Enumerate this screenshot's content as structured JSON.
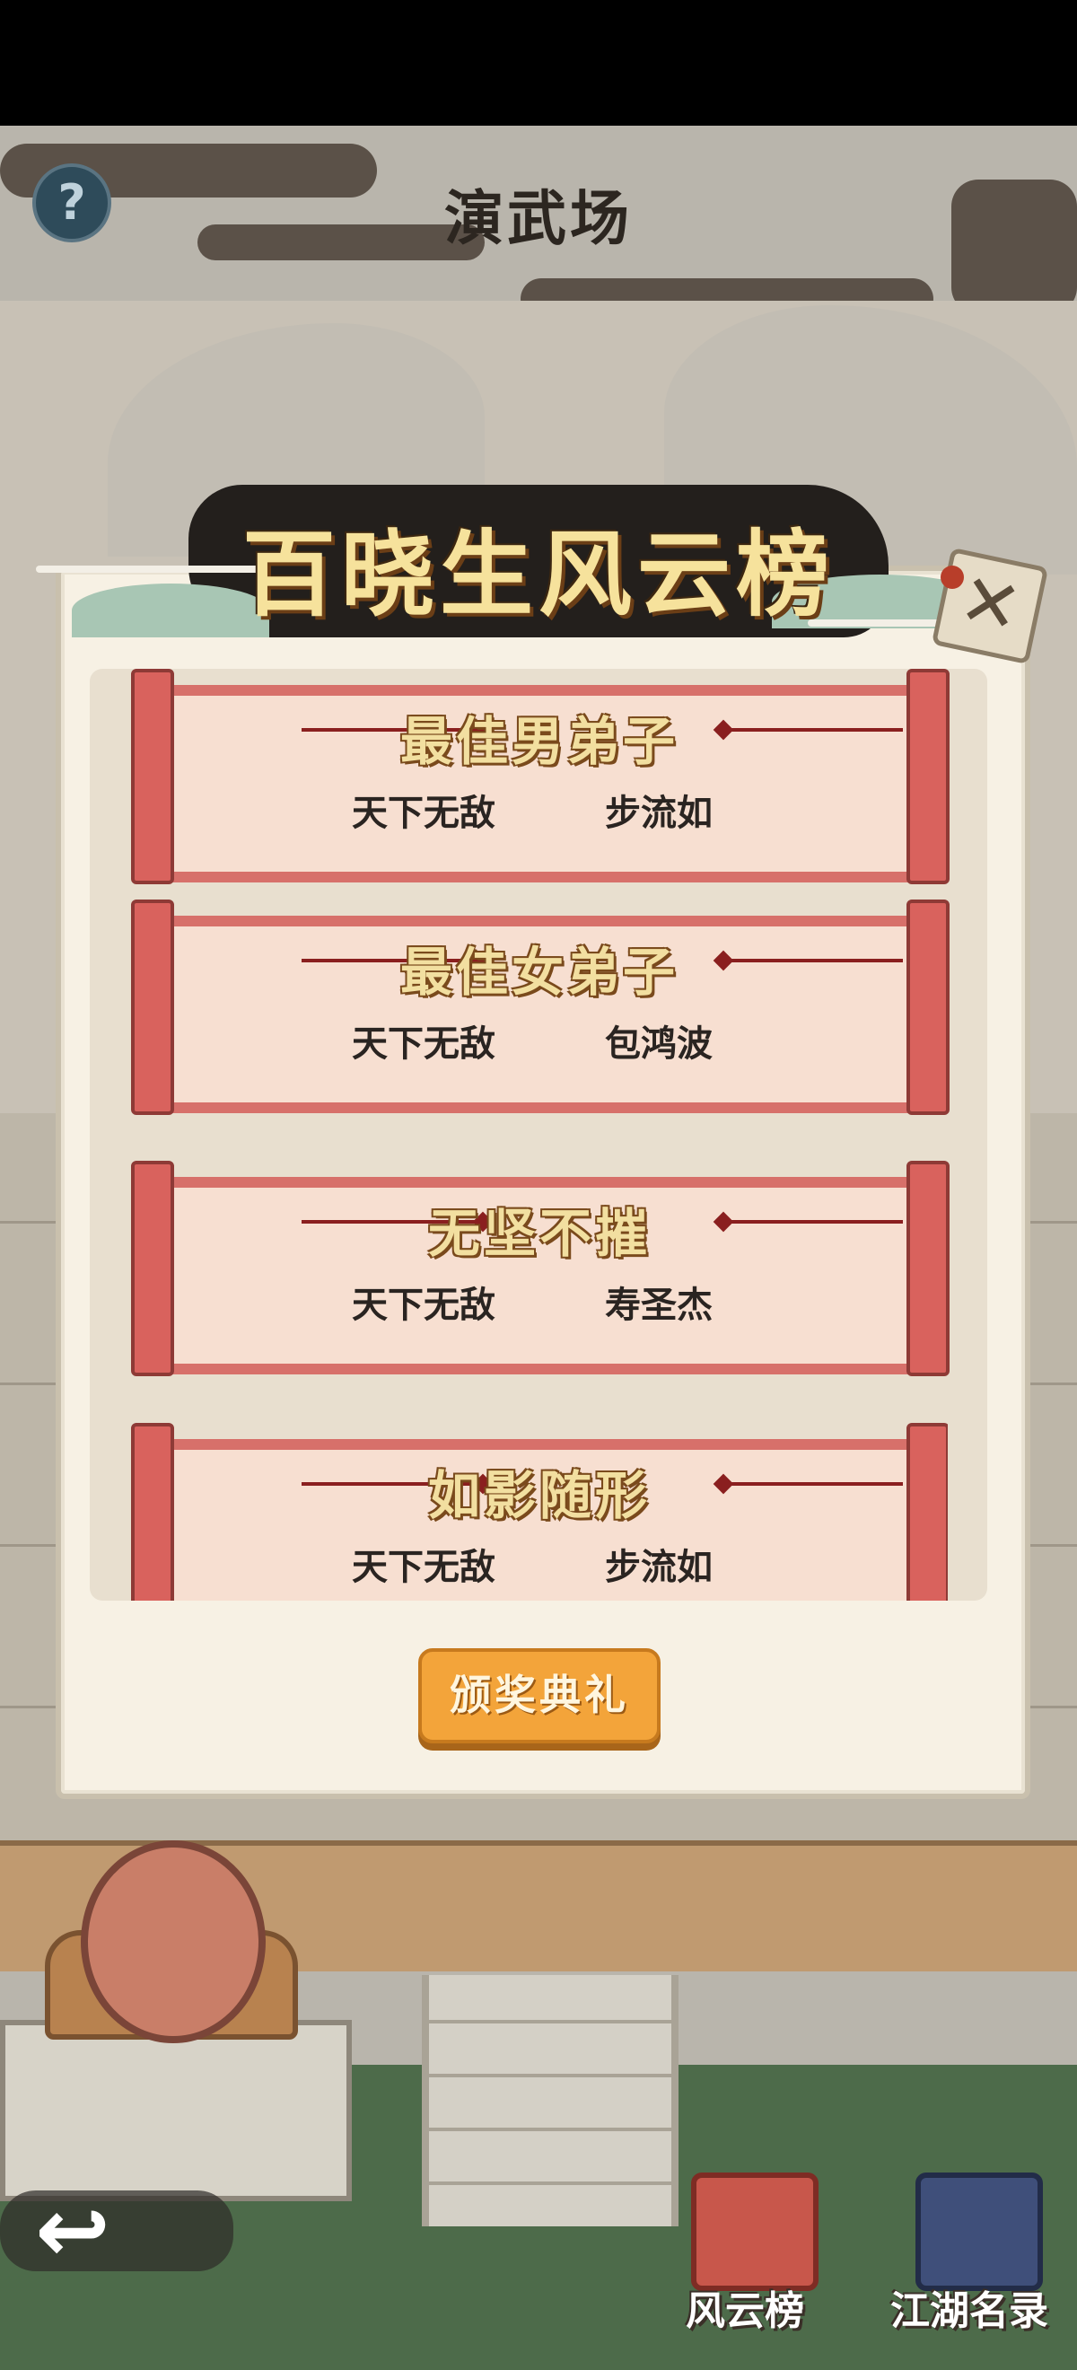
{
  "header": {
    "title": "演武场",
    "help_glyph": "?"
  },
  "dialog": {
    "title": "百晓生风云榜",
    "close_glyph": "✕",
    "entries": [
      {
        "title": "最佳男弟子",
        "rank": "天下无敌",
        "name": "步流如"
      },
      {
        "title": "最佳女弟子",
        "rank": "天下无敌",
        "name": "包鸿波"
      },
      {
        "title": "无坚不摧",
        "rank": "天下无敌",
        "name": "寿圣杰"
      },
      {
        "title": "如影随形",
        "rank": "天下无敌",
        "name": "步流如"
      }
    ],
    "award_button": "颁奖典礼"
  },
  "bottom_nav": {
    "back_glyph": "↩",
    "items": [
      {
        "label": "风云榜",
        "icon": "scroll-icon"
      },
      {
        "label": "江湖名录",
        "icon": "book-icon"
      }
    ]
  },
  "colors": {
    "scroll_red": "#d9625d",
    "award_orange": "#f3a43a",
    "paper": "#f7f1e4"
  }
}
